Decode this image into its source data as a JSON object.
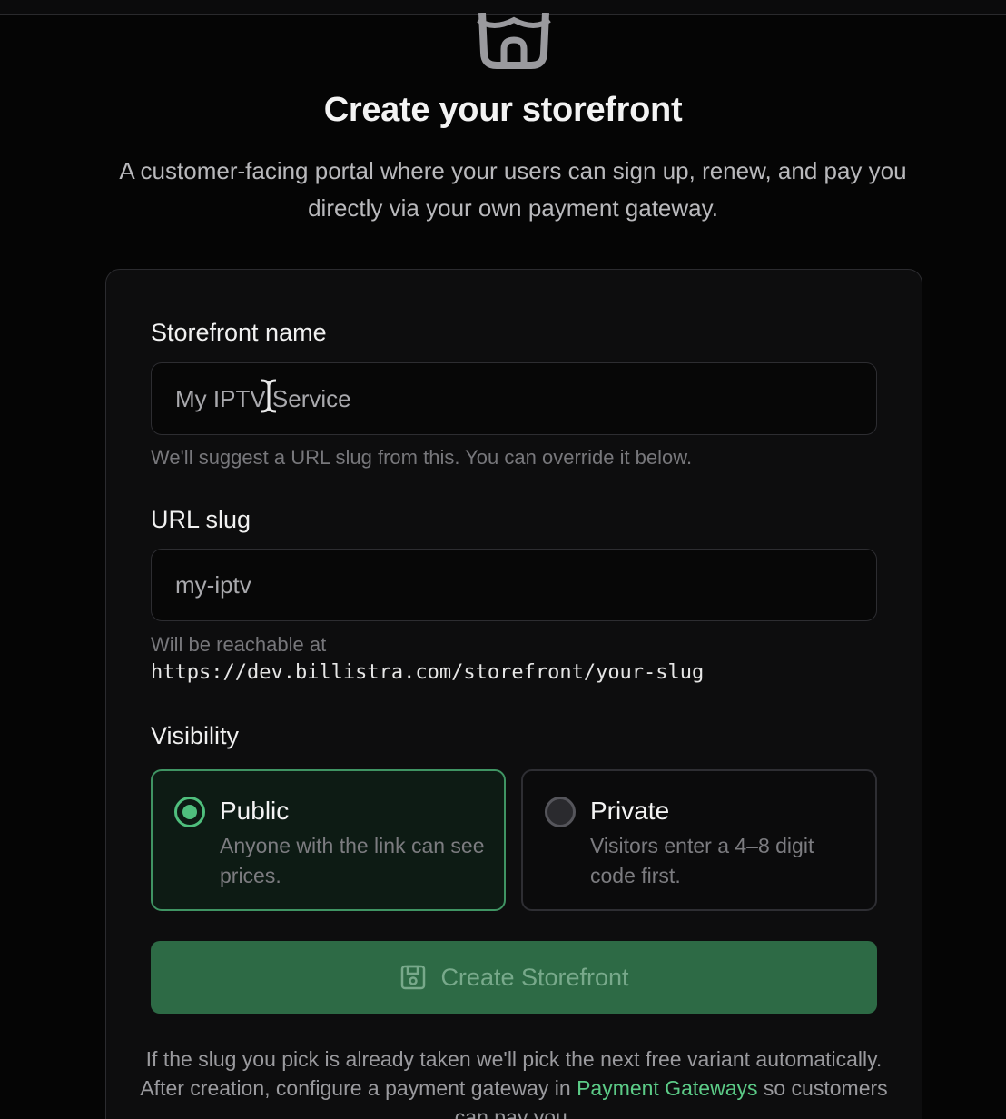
{
  "header": {
    "title": "Create your storefront",
    "subtitle": "A customer-facing portal where your users can sign up, renew, and pay you directly via your own payment gateway."
  },
  "form": {
    "name_label": "Storefront name",
    "name_placeholder": "My IPTV Service",
    "name_help": "We'll suggest a URL slug from this. You can override it below.",
    "slug_label": "URL slug",
    "slug_placeholder": "my-iptv",
    "slug_help": "Will be reachable at",
    "slug_url": "https://dev.billistra.com/storefront/your-slug",
    "visibility_label": "Visibility",
    "options": [
      {
        "title": "Public",
        "description": "Anyone with the link can see prices.",
        "selected": true
      },
      {
        "title": "Private",
        "description": "Visitors enter a 4–8 digit code first.",
        "selected": false
      }
    ],
    "submit_label": "Create Storefront"
  },
  "footnote": {
    "text_before": "If the slug you pick is already taken we'll pick the next free variant automatically. After creation, configure a payment gateway in ",
    "link": "Payment Gateways",
    "text_after": " so customers can pay you."
  },
  "colors": {
    "accent": "#4fbf7d",
    "button": "#2d6a45",
    "background": "#050505"
  },
  "icons": {
    "header": "storefront-icon",
    "button": "save-icon",
    "cursor": "text-cursor-icon"
  }
}
